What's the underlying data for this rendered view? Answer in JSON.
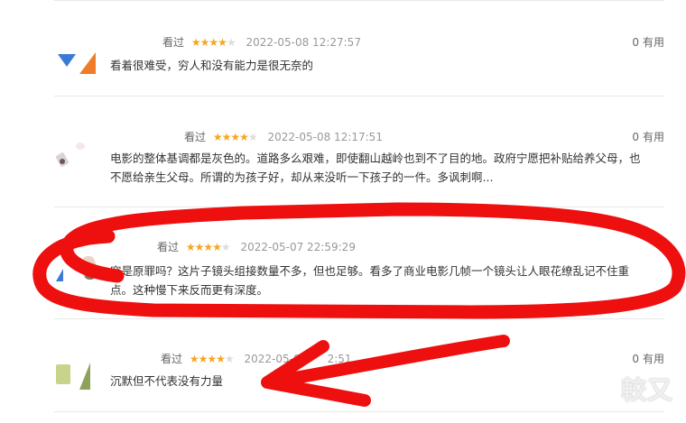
{
  "reviews": [
    {
      "status": "看过",
      "rating": 4,
      "time": "2022-05-08 12:27:57",
      "useful_count": "0",
      "useful_label": "有用",
      "content": "看着很难受，穷人和没有能力是很无奈的"
    },
    {
      "status": "看过",
      "rating": 4,
      "time": "2022-05-08 12:17:51",
      "useful_count": "0",
      "useful_label": "有用",
      "content_line1": "电影的整体基调都是灰色的。道路多么艰难，即使翻山越岭也到不了目的地。政府宁愿把补贴给养父母，也",
      "content_line2": "不愿给亲生父母。所谓的为孩子好，却从来没听一下孩子的一件。多讽刺啊..."
    },
    {
      "status": "看过",
      "rating": 4,
      "time": "2022-05-07 22:59:29",
      "content_line1": "穷是原罪吗？这片子镜头组接数量不多，但也足够。看多了商业电影几帧一个镜头让人眼花缭乱记不住重",
      "content_line2": "点。这种慢下来反而更有深度。"
    },
    {
      "status": "看过",
      "rating": 4,
      "time_visible_start": "2022-05-0",
      "time_visible_end": "2:51",
      "useful_count": "0",
      "useful_label": "有用",
      "content": "沉默但不代表没有力量"
    }
  ],
  "annotation": {
    "color": "#ee0f0f"
  },
  "watermark": "較又",
  "colors": {
    "star": "#f5a623",
    "star_off": "#dddddd",
    "meta": "#999999",
    "text": "#333333"
  }
}
